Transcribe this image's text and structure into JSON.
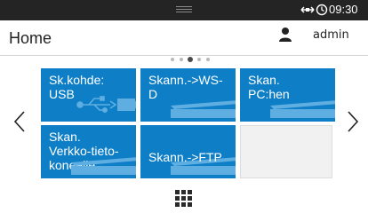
{
  "status": {
    "time": "09:30"
  },
  "header": {
    "title": "Home",
    "user": "admin"
  },
  "pager": {
    "pages": 5,
    "current": 3
  },
  "tiles": [
    {
      "label": "Sk.kohde:\nUSB",
      "icon": "usb-icon"
    },
    {
      "label": "Skann.->WS-\nD",
      "icon": "scanner-icon"
    },
    {
      "label": "Skan.\nPC:hen",
      "icon": "scanner-icon"
    },
    {
      "label": "Skan.\nVerkko-tieto-\nkoneelle",
      "icon": "scanner-icon"
    },
    {
      "label": "Skann.->FTP",
      "icon": "scanner-icon"
    }
  ],
  "colors": {
    "tile": "#0e7ec6",
    "statusbar": "#242424",
    "empty_tile": "#f1f1f1"
  }
}
